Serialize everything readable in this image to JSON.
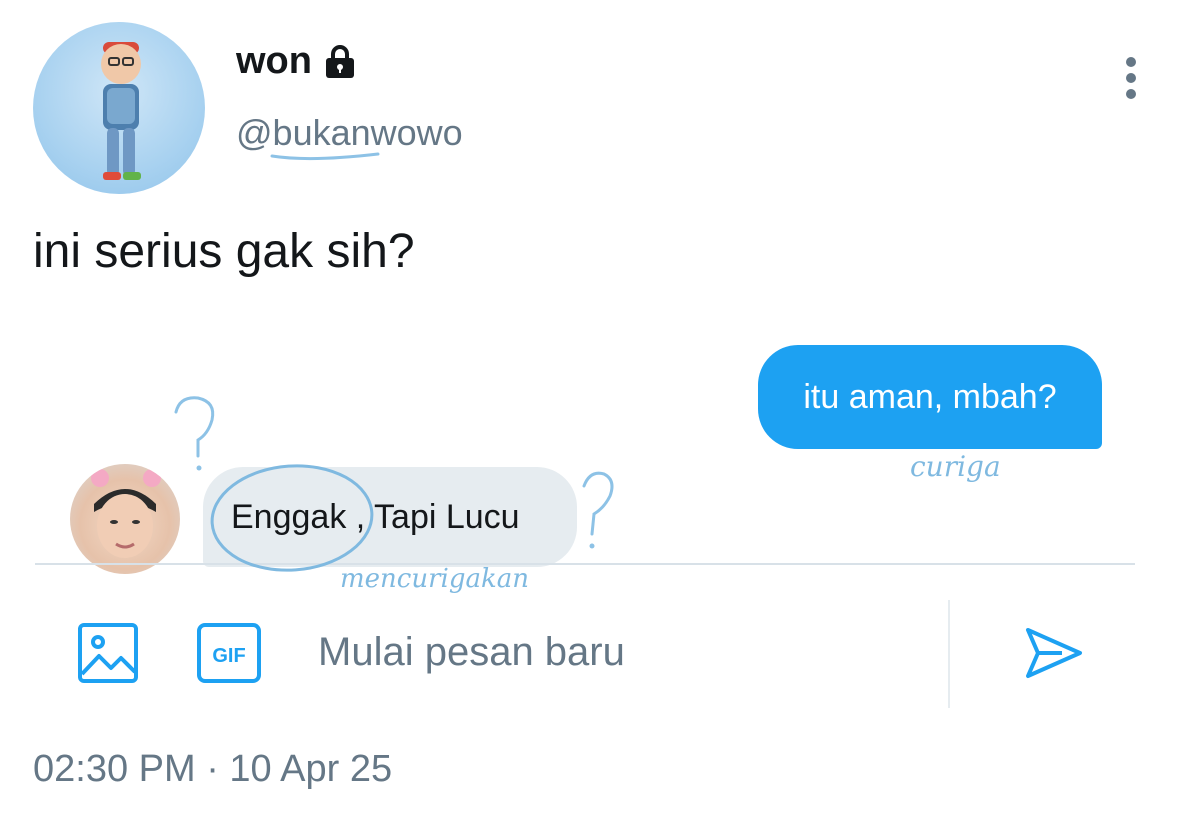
{
  "tweet": {
    "display_name": "won",
    "handle": "@bukanwowo",
    "text": "ini serius gak sih?",
    "timestamp": "02:30 PM · 10 Apr 25"
  },
  "dm": {
    "outgoing_message": "itu aman, mbah?",
    "incoming_message": "Enggak , Tapi Lucu",
    "composer": {
      "gif_label": "GIF",
      "placeholder": "Mulai pesan baru"
    }
  },
  "annotations": {
    "under_outgoing": "curiga",
    "under_incoming": "mencurigakan"
  },
  "icons": {
    "lock": "lock-icon",
    "more": "more-vertical-icon",
    "image": "image-icon",
    "gif": "gif-icon",
    "send": "send-icon"
  },
  "colors": {
    "accent": "#1da1f2",
    "annotation": "#7fb9e0",
    "secondary_text": "#657786"
  }
}
